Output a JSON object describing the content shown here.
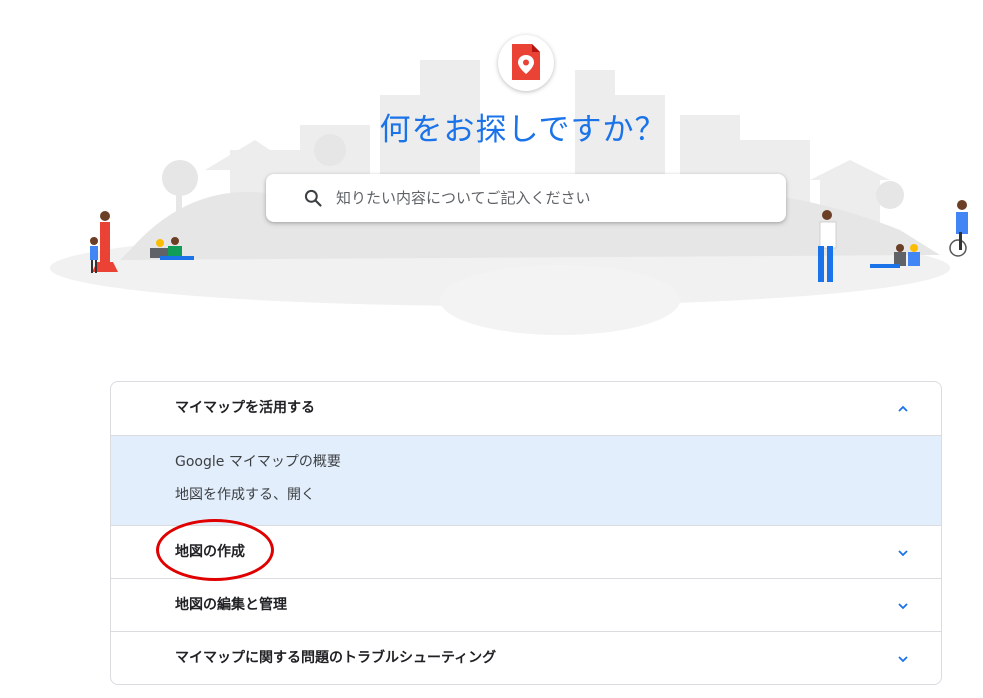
{
  "hero": {
    "title": "何をお探しですか？",
    "app_icon": "my-maps-icon"
  },
  "search": {
    "placeholder": "知りたい内容についてご記入ください",
    "value": ""
  },
  "sections": [
    {
      "title": "マイマップを活用する",
      "expanded": true,
      "links": [
        "Google マイマップの概要",
        "地図を作成する、開く"
      ]
    },
    {
      "title": "地図の作成",
      "expanded": false
    },
    {
      "title": "地図の編集と管理",
      "expanded": false
    },
    {
      "title": "マイマップに関する問題のトラブルシューティング",
      "expanded": false
    }
  ],
  "colors": {
    "accent": "#1a73e8",
    "app_icon": "#ea4335",
    "expanded_bg": "#e3eefc",
    "annotation": "#e00000"
  }
}
